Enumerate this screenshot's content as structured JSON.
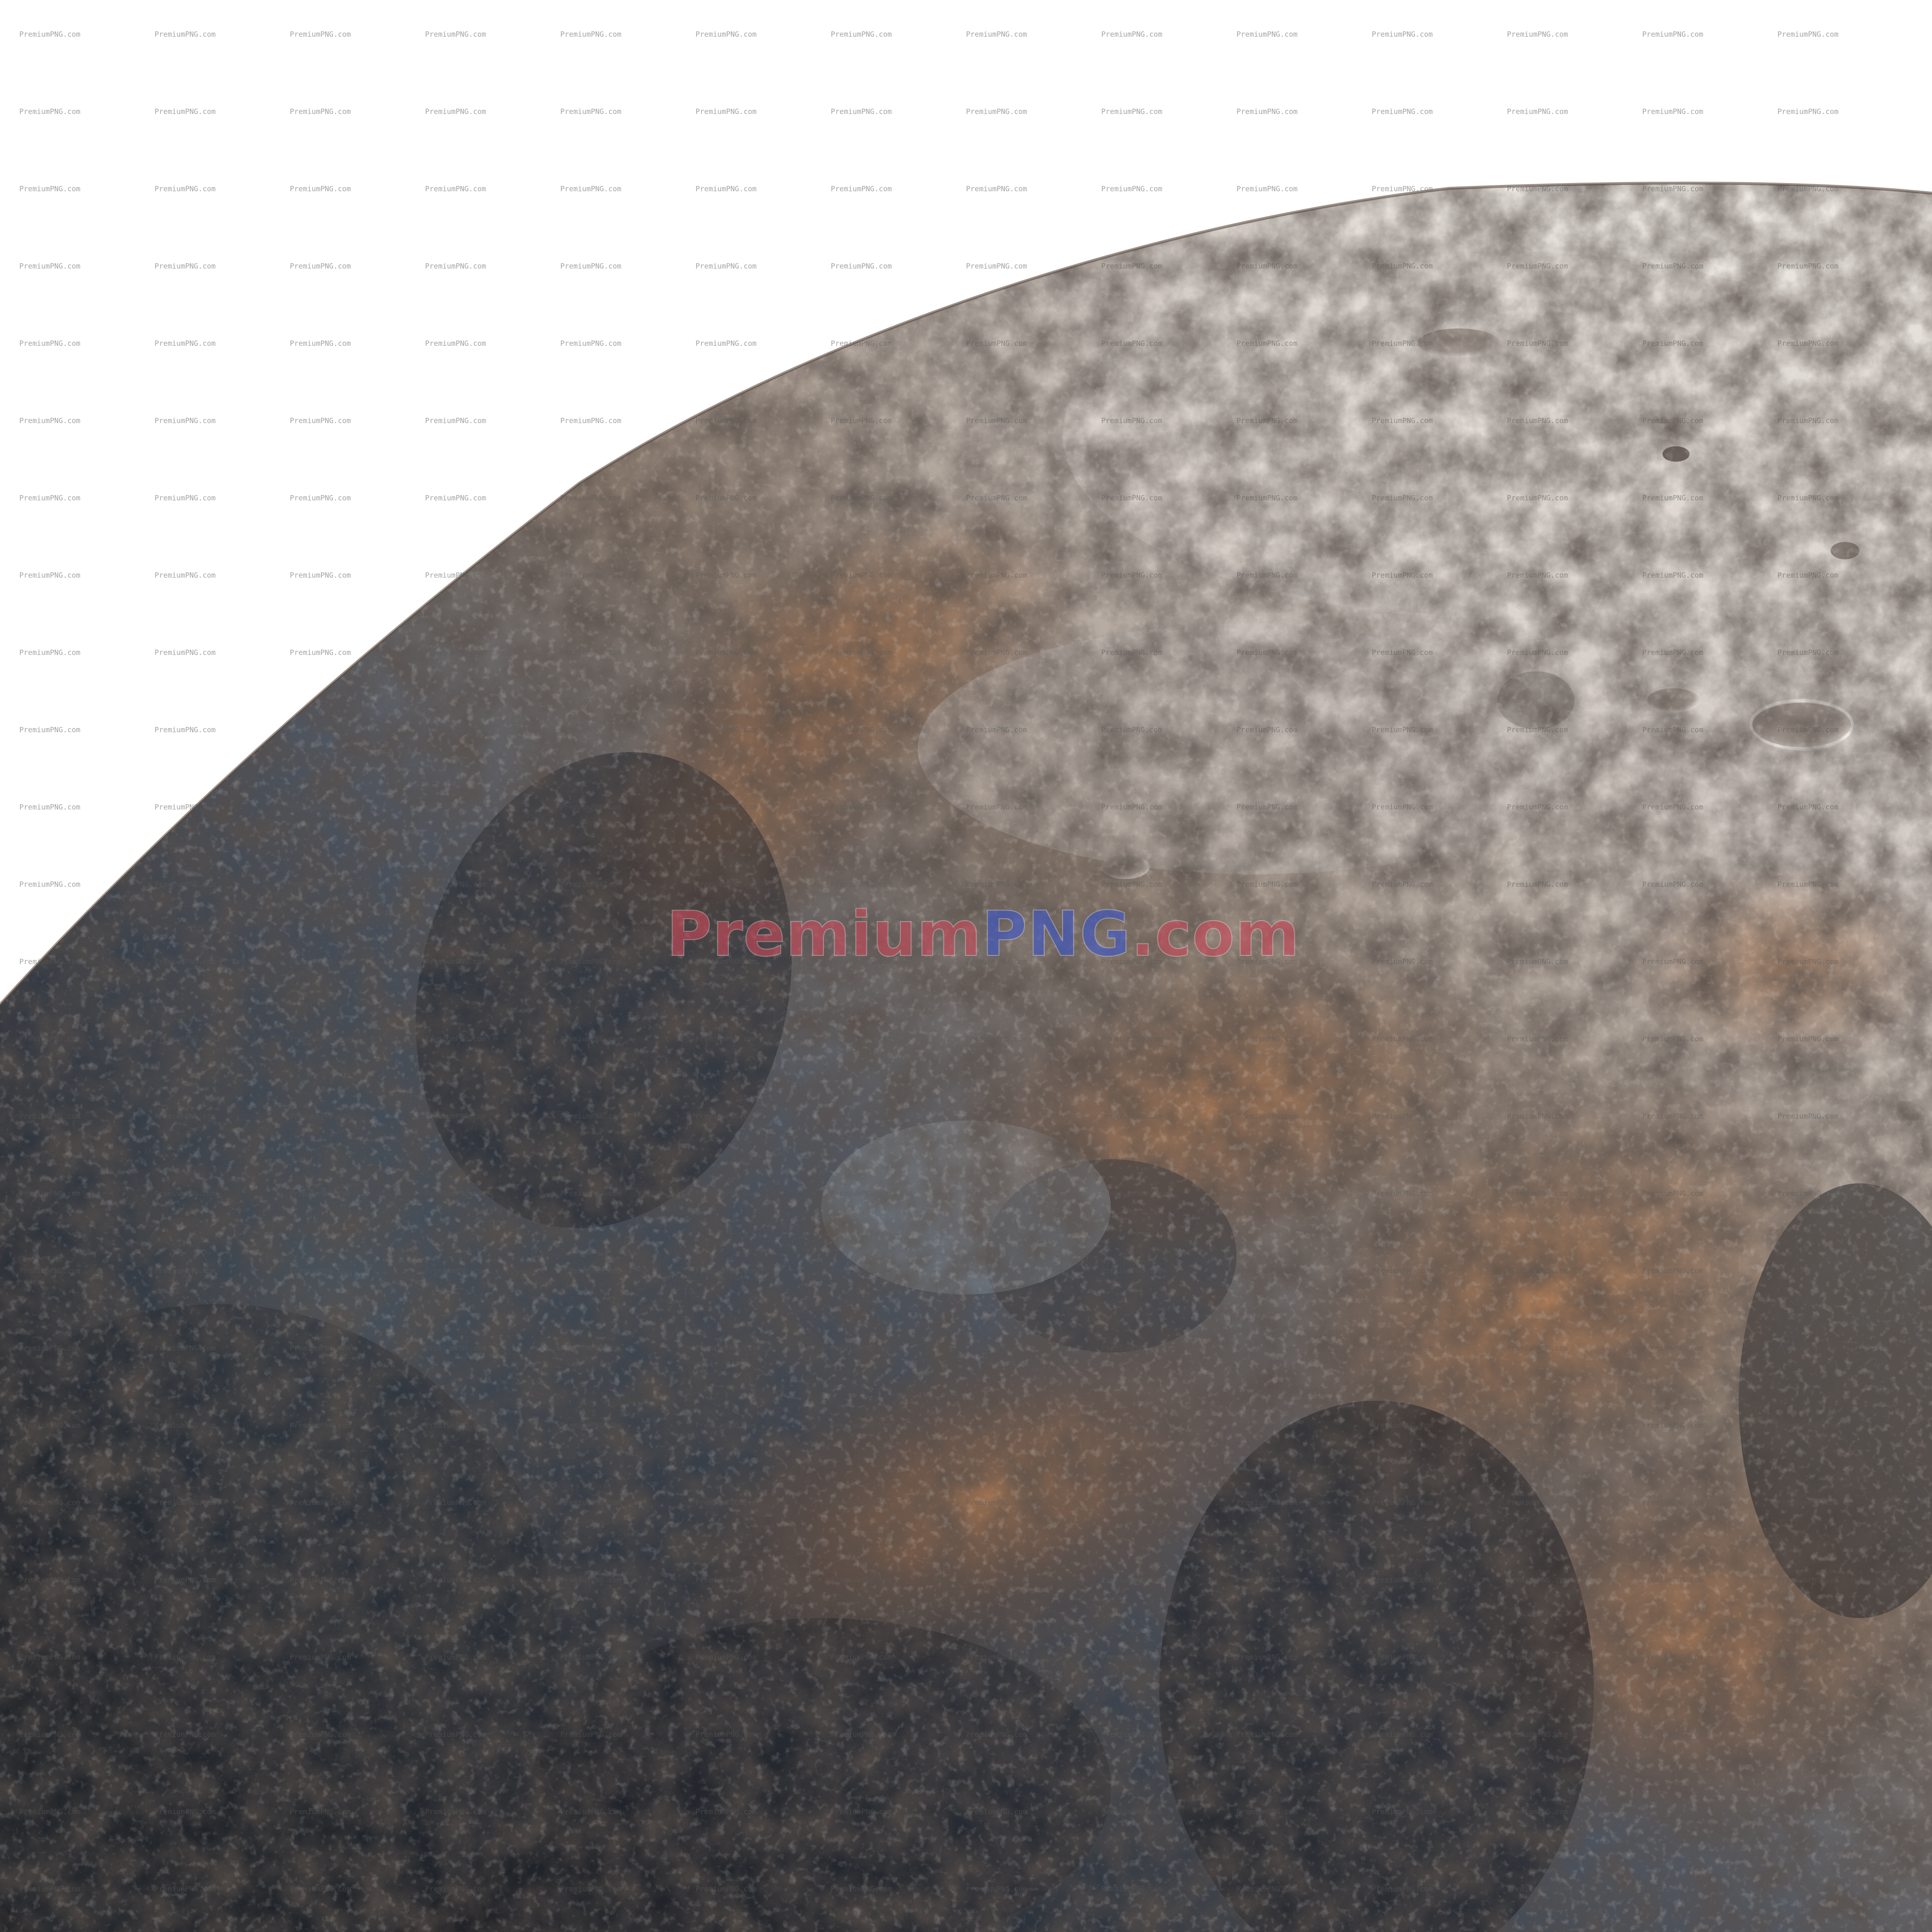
{
  "watermark": {
    "tile_text": "PremiumPNG.com",
    "center_parts": [
      "Premium",
      "PNG",
      ".com"
    ],
    "center_colors": [
      "#c94a5a",
      "#3d56c9",
      "#c94a5a"
    ]
  },
  "scene": {
    "subject": "cratered planetary surface",
    "background_color": "#ffffff",
    "palette": {
      "shadow_slate": "#3e4a55",
      "deep_shadow": "#1d2026",
      "rust_ridge": "#8a5a3c",
      "warm_highlight": "#c9a484",
      "pale_plain": "#cdc8c3",
      "bright_rim": "#ebe6e1"
    }
  }
}
